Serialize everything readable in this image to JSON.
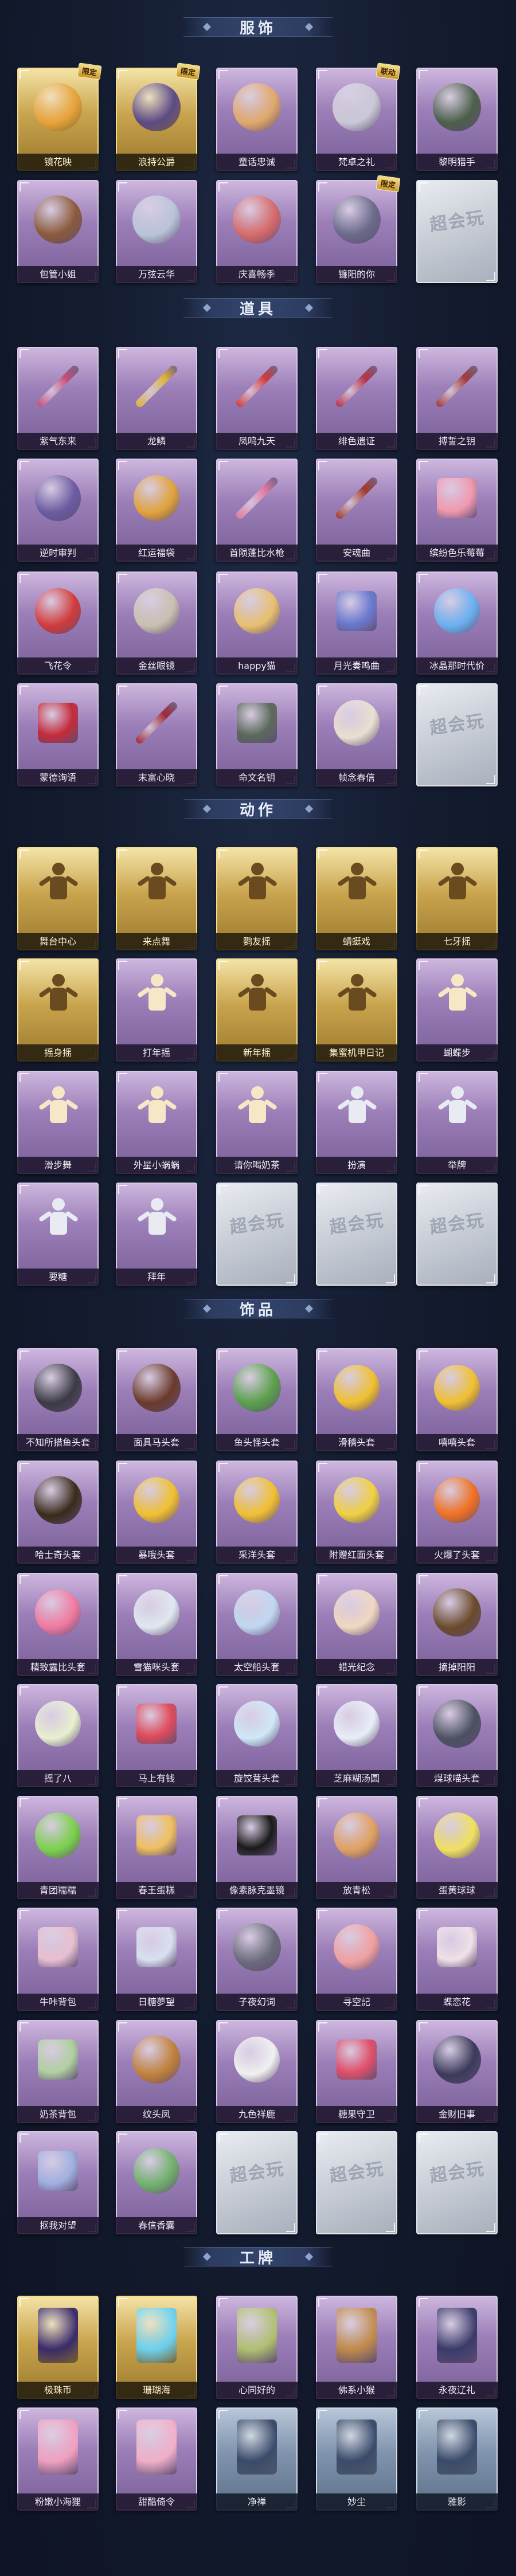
{
  "sections": [
    {
      "title": "服饰",
      "items": [
        {
          "label": "镜花映",
          "type": "gold",
          "art": "head",
          "color": "#e8a23a",
          "badge": "限定"
        },
        {
          "label": "浪持公爵",
          "type": "gold",
          "art": "head",
          "color": "#5b4a86",
          "badge": "限定"
        },
        {
          "label": "童话忠诚",
          "type": "purple",
          "art": "head",
          "color": "#e0a86a"
        },
        {
          "label": "梵卓之礼",
          "type": "purple",
          "art": "head",
          "color": "#c9c9d6",
          "badge": "联动"
        },
        {
          "label": "黎明猎手",
          "type": "purple",
          "art": "head",
          "color": "#4b5f4a"
        },
        {
          "label": "包管小姐",
          "type": "purple",
          "art": "head",
          "color": "#8a5a3a"
        },
        {
          "label": "万弦云华",
          "type": "purple",
          "art": "head",
          "color": "#b9c4d9"
        },
        {
          "label": "庆喜畅季",
          "type": "purple",
          "art": "head",
          "color": "#d66a6a"
        },
        {
          "label": "镰阳的你",
          "type": "purple",
          "art": "head",
          "color": "#6a6a8a",
          "badge": "限定"
        },
        {
          "label": "",
          "type": "placeholder",
          "art": "placeholder"
        }
      ]
    },
    {
      "title": "道具",
      "items": [
        {
          "label": "紫气东来",
          "type": "purple",
          "art": "weapon",
          "color": "#c44d7a"
        },
        {
          "label": "龙鳞",
          "type": "purple",
          "art": "weapon",
          "color": "#e0b23a"
        },
        {
          "label": "凤鸣九天",
          "type": "purple",
          "art": "weapon",
          "color": "#d23a3a"
        },
        {
          "label": "绯色遗证",
          "type": "purple",
          "art": "weapon",
          "color": "#b8324a"
        },
        {
          "label": "搏誓之钥",
          "type": "purple",
          "art": "weapon",
          "color": "#a23a3a"
        },
        {
          "label": "逆时审判",
          "type": "purple",
          "art": "ball",
          "color": "#6a5aa0"
        },
        {
          "label": "红运福袋",
          "type": "purple",
          "art": "ball",
          "color": "#e0a23a"
        },
        {
          "label": "首陨蓬比水枪",
          "type": "purple",
          "art": "weapon",
          "color": "#e07aa0"
        },
        {
          "label": "安魂曲",
          "type": "purple",
          "art": "weapon",
          "color": "#a23a2a"
        },
        {
          "label": "缤纷色乐莓莓",
          "type": "purple",
          "art": "box",
          "color": "#f09ab0"
        },
        {
          "label": "飞花令",
          "type": "purple",
          "art": "ball",
          "color": "#d23a3a"
        },
        {
          "label": "金丝眼镜",
          "type": "purple",
          "art": "ball",
          "color": "#c9c0b0"
        },
        {
          "label": "happy猫",
          "type": "purple",
          "art": "ball",
          "color": "#e8c070"
        },
        {
          "label": "月光奏鸣曲",
          "type": "purple",
          "art": "box",
          "color": "#6a7ad0"
        },
        {
          "label": "冰晶那时代价",
          "type": "purple",
          "art": "ball",
          "color": "#6ab0f0"
        },
        {
          "label": "蒙德询语",
          "type": "purple",
          "art": "box",
          "color": "#c42a3a"
        },
        {
          "label": "末富心晓",
          "type": "purple",
          "art": "weapon",
          "color": "#a02a3a"
        },
        {
          "label": "命文名钥",
          "type": "purple",
          "art": "box",
          "color": "#5a6a5a"
        },
        {
          "label": "帧念春信",
          "type": "purple",
          "art": "ball",
          "color": "#e8e0d0"
        },
        {
          "label": "",
          "type": "placeholder",
          "art": "placeholder"
        }
      ]
    },
    {
      "title": "动作",
      "items": [
        {
          "label": "舞台中心",
          "type": "gold",
          "art": "pose"
        },
        {
          "label": "来点舞",
          "type": "gold",
          "art": "pose"
        },
        {
          "label": "鹦友摇",
          "type": "gold",
          "art": "pose"
        },
        {
          "label": "蜻蜓戏",
          "type": "gold",
          "art": "pose"
        },
        {
          "label": "七牙摇",
          "type": "gold",
          "art": "pose"
        },
        {
          "label": "摇身摇",
          "type": "gold",
          "art": "pose"
        },
        {
          "label": "打年摇",
          "type": "purple",
          "art": "pose-light"
        },
        {
          "label": "新年摇",
          "type": "gold",
          "art": "pose"
        },
        {
          "label": "集蜜机甲日记",
          "type": "gold",
          "art": "pose"
        },
        {
          "label": "蝴蝶步",
          "type": "purple",
          "art": "pose-light"
        },
        {
          "label": "滑步舞",
          "type": "purple",
          "art": "pose-light"
        },
        {
          "label": "外星小蜗蜗",
          "type": "purple",
          "art": "pose-light"
        },
        {
          "label": "请你喝奶茶",
          "type": "purple",
          "art": "pose-light"
        },
        {
          "label": "扮演",
          "type": "purple",
          "art": "pose-white"
        },
        {
          "label": "举牌",
          "type": "purple",
          "art": "pose-white"
        },
        {
          "label": "要糖",
          "type": "purple",
          "art": "pose-white"
        },
        {
          "label": "拜年",
          "type": "purple",
          "art": "pose-white"
        },
        {
          "label": "",
          "type": "placeholder",
          "art": "placeholder"
        },
        {
          "label": "",
          "type": "placeholder",
          "art": "placeholder"
        },
        {
          "label": "",
          "type": "placeholder",
          "art": "placeholder"
        }
      ]
    },
    {
      "title": "饰品",
      "items": [
        {
          "label": "不知所措鱼头套",
          "type": "purple",
          "art": "head",
          "color": "#3a3a44"
        },
        {
          "label": "面具马头套",
          "type": "purple",
          "art": "head",
          "color": "#6a3a2a"
        },
        {
          "label": "鱼头怪头套",
          "type": "purple",
          "art": "head",
          "color": "#5aa04a"
        },
        {
          "label": "滑稽头套",
          "type": "purple",
          "art": "ball",
          "color": "#f0c030"
        },
        {
          "label": "嘻嘻头套",
          "type": "purple",
          "art": "ball",
          "color": "#f0c030"
        },
        {
          "label": "哈士奇头套",
          "type": "purple",
          "art": "head",
          "color": "#3a2a1a"
        },
        {
          "label": "暴哦头套",
          "type": "purple",
          "art": "ball",
          "color": "#f0c030"
        },
        {
          "label": "采洋头套",
          "type": "purple",
          "art": "ball",
          "color": "#f0c030"
        },
        {
          "label": "附赠红面头套",
          "type": "purple",
          "art": "ball",
          "color": "#f0d040"
        },
        {
          "label": "火爆了头套",
          "type": "purple",
          "art": "ball",
          "color": "#f07020"
        },
        {
          "label": "精致露比头套",
          "type": "purple",
          "art": "ball",
          "color": "#f07aa0"
        },
        {
          "label": "雪猫咪头套",
          "type": "purple",
          "art": "ball",
          "color": "#e0e8f0"
        },
        {
          "label": "太空船头套",
          "type": "purple",
          "art": "ball",
          "color": "#c0d8f0"
        },
        {
          "label": "蜡光纪念",
          "type": "purple",
          "art": "ball",
          "color": "#f0d8c0"
        },
        {
          "label": "摘掉阳阳",
          "type": "purple",
          "art": "head",
          "color": "#6a4a2a"
        },
        {
          "label": "摇了八",
          "type": "purple",
          "art": "ball",
          "color": "#e8f0d0"
        },
        {
          "label": "马上有钱",
          "type": "purple",
          "art": "box",
          "color": "#e04a5a"
        },
        {
          "label": "旋饺茸头套",
          "type": "purple",
          "art": "ball",
          "color": "#d0e8f8"
        },
        {
          "label": "芝麻糊汤圆",
          "type": "purple",
          "art": "ball",
          "color": "#e8eef8"
        },
        {
          "label": "煤球喵头套",
          "type": "purple",
          "art": "head",
          "color": "#4a5060"
        },
        {
          "label": "青团糯糯",
          "type": "purple",
          "art": "ball",
          "color": "#7ad04a"
        },
        {
          "label": "春王蛋糕",
          "type": "purple",
          "art": "box",
          "color": "#f0c060"
        },
        {
          "label": "像素脉克墨镜",
          "type": "purple",
          "art": "box",
          "color": "#1a1a1a"
        },
        {
          "label": "放青松",
          "type": "purple",
          "art": "ball",
          "color": "#e0a060"
        },
        {
          "label": "蛋黄球球",
          "type": "purple",
          "art": "ball",
          "color": "#f0e060"
        },
        {
          "label": "牛咔背包",
          "type": "purple",
          "art": "box",
          "color": "#e8c0d0"
        },
        {
          "label": "日糖夢望",
          "type": "purple",
          "art": "box",
          "color": "#d8e0f0"
        },
        {
          "label": "子夜幻词",
          "type": "purple",
          "art": "head",
          "color": "#6a6a7a"
        },
        {
          "label": "寻空記",
          "type": "purple",
          "art": "ball",
          "color": "#f0a0a0"
        },
        {
          "label": "蝶恋花",
          "type": "purple",
          "art": "box",
          "color": "#f0e0e8"
        },
        {
          "label": "奶茶背包",
          "type": "purple",
          "art": "box",
          "color": "#b0d0a0"
        },
        {
          "label": "纹头凤",
          "type": "purple",
          "art": "head",
          "color": "#c0803a"
        },
        {
          "label": "九色祥鹿",
          "type": "purple",
          "art": "ball",
          "color": "#f0f0f0"
        },
        {
          "label": "糖果守卫",
          "type": "purple",
          "art": "box",
          "color": "#e0506a"
        },
        {
          "label": "金财旧事",
          "type": "purple",
          "art": "head",
          "color": "#3a3a5a"
        },
        {
          "label": "抠我对望",
          "type": "purple",
          "art": "box",
          "color": "#a0b0e0"
        },
        {
          "label": "春信香囊",
          "type": "purple",
          "art": "ball",
          "color": "#70b06a"
        },
        {
          "label": "",
          "type": "placeholder",
          "art": "placeholder"
        },
        {
          "label": "",
          "type": "placeholder",
          "art": "placeholder"
        },
        {
          "label": "",
          "type": "placeholder",
          "art": "placeholder"
        }
      ]
    },
    {
      "title": "工牌",
      "items": [
        {
          "label": "极珠币",
          "type": "gold",
          "art": "card",
          "color": "#3a2a6a"
        },
        {
          "label": "珊瑚海",
          "type": "gold",
          "art": "card",
          "color": "#6ad0f0"
        },
        {
          "label": "心同好的",
          "type": "purple",
          "art": "card",
          "color": "#b0c070"
        },
        {
          "label": "佛系小猴",
          "type": "purple",
          "art": "card",
          "color": "#c08a4a"
        },
        {
          "label": "永夜辽礼",
          "type": "purple",
          "art": "card",
          "color": "#3a3a6a"
        },
        {
          "label": "粉嫩小海狸",
          "type": "purple",
          "art": "card",
          "color": "#f0a0c0"
        },
        {
          "label": "甜酷倚令",
          "type": "purple",
          "art": "card",
          "color": "#f0b0c8"
        },
        {
          "label": "净禅",
          "type": "blue",
          "art": "card",
          "color": "#3a4a6a"
        },
        {
          "label": "妙尘",
          "type": "blue",
          "art": "card",
          "color": "#3a4a6a"
        },
        {
          "label": "雅影",
          "type": "blue",
          "art": "card",
          "color": "#3a4a6a"
        }
      ]
    }
  ],
  "placeholder_text": "超会玩"
}
